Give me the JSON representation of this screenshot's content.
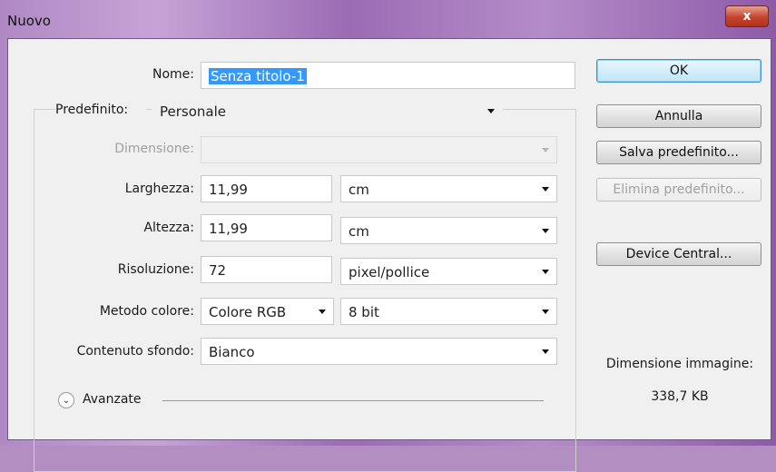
{
  "window": {
    "title": "Nuovo",
    "close_label": "x"
  },
  "form": {
    "name_label": "Nome:",
    "name_value": "Senza titolo-1",
    "preset_label": "Predefinito:",
    "preset_value": "Personale",
    "size_label": "Dimensione:",
    "size_value": "",
    "width_label": "Larghezza:",
    "width_value": "11,99",
    "width_unit": "cm",
    "height_label": "Altezza:",
    "height_value": "11,99",
    "height_unit": "cm",
    "resolution_label": "Risoluzione:",
    "resolution_value": "72",
    "resolution_unit": "pixel/pollice",
    "color_mode_label": "Metodo colore:",
    "color_mode_value": "Colore RGB",
    "bit_depth_value": "8 bit",
    "background_label": "Contenuto sfondo:",
    "background_value": "Bianco",
    "advanced_label": "Avanzate"
  },
  "buttons": {
    "ok": "OK",
    "cancel": "Annulla",
    "save_preset": "Salva predefinito...",
    "delete_preset": "Elimina predefinito...",
    "device_central": "Device Central..."
  },
  "info": {
    "image_size_label": "Dimensione immagine:",
    "image_size_value": "338,7 KB"
  }
}
